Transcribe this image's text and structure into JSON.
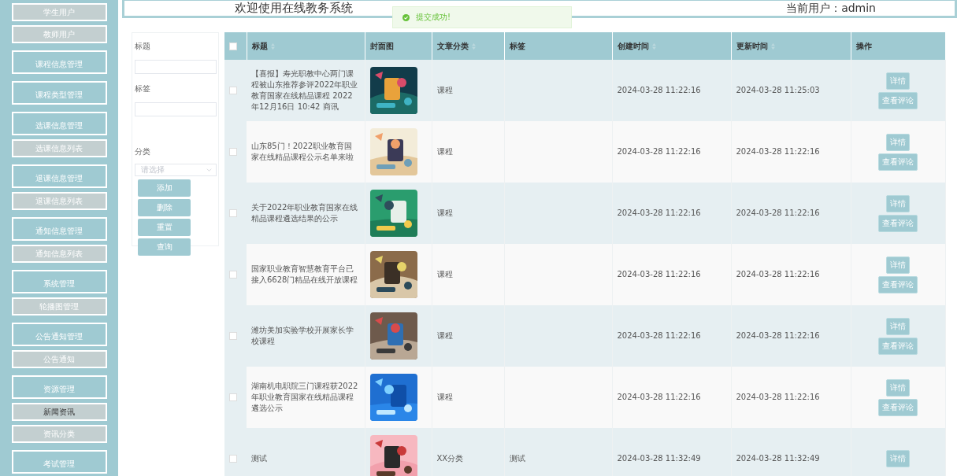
{
  "sidebar": {
    "items": [
      {
        "label": "学生用户",
        "kind": "sub",
        "selected": false
      },
      {
        "label": "教师用户",
        "kind": "sub",
        "selected": false
      },
      {
        "label": "课程信息管理",
        "kind": "group",
        "selected": false
      },
      {
        "label": "课程类型管理",
        "kind": "group",
        "selected": false
      },
      {
        "label": "选课信息管理",
        "kind": "group",
        "selected": false
      },
      {
        "label": "选课信息列表",
        "kind": "sub",
        "selected": false
      },
      {
        "label": "退课信息管理",
        "kind": "group",
        "selected": false
      },
      {
        "label": "退课信息列表",
        "kind": "sub",
        "selected": false
      },
      {
        "label": "通知信息管理",
        "kind": "group",
        "selected": false
      },
      {
        "label": "通知信息列表",
        "kind": "sub",
        "selected": false
      },
      {
        "label": "系统管理",
        "kind": "group",
        "selected": false
      },
      {
        "label": "轮播图管理",
        "kind": "sub",
        "selected": false
      },
      {
        "label": "公告通知管理",
        "kind": "group",
        "selected": false
      },
      {
        "label": "公告通知",
        "kind": "sub",
        "selected": false
      },
      {
        "label": "资源管理",
        "kind": "group",
        "selected": false
      },
      {
        "label": "新闻资讯",
        "kind": "sub",
        "selected": true
      },
      {
        "label": "资讯分类",
        "kind": "sub",
        "selected": false
      },
      {
        "label": "考试管理",
        "kind": "group",
        "selected": false
      }
    ]
  },
  "header": {
    "title": "欢迎使用在线教务系统",
    "current_user": "当前用户：admin"
  },
  "toast": {
    "message": "提交成功!"
  },
  "filter": {
    "fields": [
      {
        "label": "标题",
        "kind": "text"
      },
      {
        "label": "标签",
        "kind": "text"
      },
      {
        "label": "分类",
        "kind": "select",
        "placeholder": "请选择"
      }
    ],
    "buttons": [
      "添加",
      "删除",
      "重置",
      "查询"
    ]
  },
  "table": {
    "columns": [
      {
        "label": "标题",
        "sortable": true
      },
      {
        "label": "封面图",
        "sortable": false
      },
      {
        "label": "文章分类",
        "sortable": true
      },
      {
        "label": "标签",
        "sortable": false
      },
      {
        "label": "创建时间",
        "sortable": true
      },
      {
        "label": "更新时间",
        "sortable": true
      },
      {
        "label": "操作",
        "sortable": false
      }
    ],
    "select_all": {
      "checked": false
    },
    "rows": [
      {
        "checked": false,
        "title": "【喜报】寿光职教中心两门课程被山东推荐参评2022年职业教育国家在线精品课程 2022年12月16日 10:42 商讯",
        "cover": {
          "kind": "picture"
        },
        "category": "课程",
        "tags": "",
        "created": "2024-03-28 11:22:16",
        "updated": "2024-03-28 11:25:03",
        "actions": [
          "详情",
          "查看评论"
        ]
      },
      {
        "checked": false,
        "title": "山东85门！2022职业教育国家在线精品课程公示名单来啦",
        "cover": {
          "kind": "picture"
        },
        "category": "课程",
        "tags": "",
        "created": "2024-03-28 11:22:16",
        "updated": "2024-03-28 11:22:16",
        "actions": [
          "详情",
          "查看评论"
        ]
      },
      {
        "checked": false,
        "title": "关于2022年职业教育国家在线精品课程遴选结果的公示",
        "cover": {
          "kind": "picture"
        },
        "category": "课程",
        "tags": "",
        "created": "2024-03-28 11:22:16",
        "updated": "2024-03-28 11:22:16",
        "actions": [
          "详情",
          "查看评论"
        ]
      },
      {
        "checked": false,
        "title": "国家职业教育智慧教育平台已接入6628门精品在线开放课程",
        "cover": {
          "kind": "picture"
        },
        "category": "课程",
        "tags": "",
        "created": "2024-03-28 11:22:16",
        "updated": "2024-03-28 11:22:16",
        "actions": [
          "详情",
          "查看评论"
        ]
      },
      {
        "checked": false,
        "title": "潍坊美加实验学校开展家长学校课程",
        "cover": {
          "kind": "picture"
        },
        "category": "课程",
        "tags": "",
        "created": "2024-03-28 11:22:16",
        "updated": "2024-03-28 11:22:16",
        "actions": [
          "详情",
          "查看评论"
        ]
      },
      {
        "checked": false,
        "title": "湖南机电职院三门课程获2022年职业教育国家在线精品课程遴选公示",
        "cover": {
          "kind": "picture"
        },
        "category": "课程",
        "tags": "",
        "created": "2024-03-28 11:22:16",
        "updated": "2024-03-28 11:22:16",
        "actions": [
          "详情",
          "查看评论"
        ]
      },
      {
        "checked": false,
        "title": "测试",
        "cover": {
          "kind": "picture"
        },
        "category": "XX分类",
        "tags": "测试",
        "created": "2024-03-28 11:32:49",
        "updated": "2024-03-28 11:32:49",
        "actions": [
          "详情"
        ]
      }
    ]
  }
}
